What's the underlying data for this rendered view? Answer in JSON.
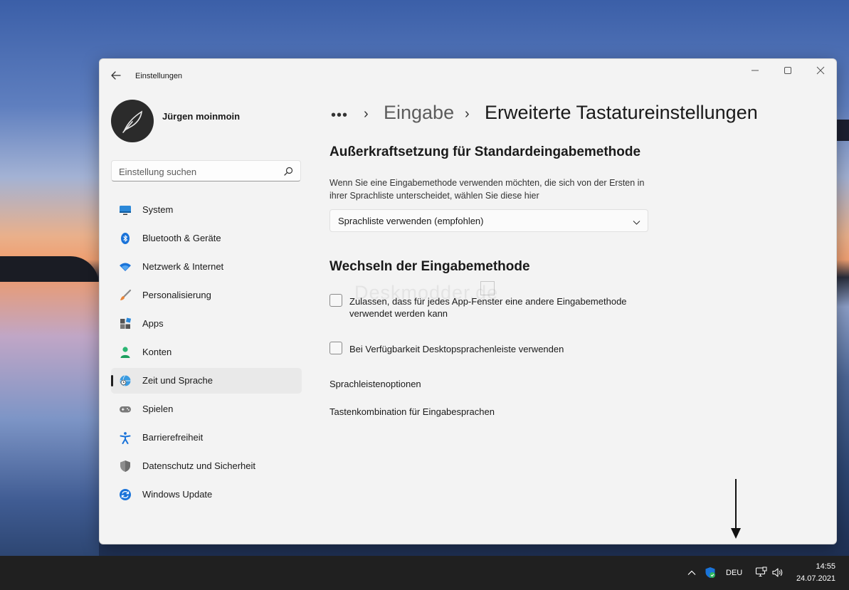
{
  "app": {
    "title": "Einstellungen"
  },
  "profile": {
    "name": "Jürgen moinmoin"
  },
  "search": {
    "placeholder": "Einstellung suchen"
  },
  "sidebar": {
    "items": [
      {
        "label": "System",
        "icon": "monitor-icon",
        "active": false
      },
      {
        "label": "Bluetooth & Geräte",
        "icon": "bluetooth-icon",
        "active": false
      },
      {
        "label": "Netzwerk & Internet",
        "icon": "wifi-icon",
        "active": false
      },
      {
        "label": "Personalisierung",
        "icon": "brush-icon",
        "active": false
      },
      {
        "label": "Apps",
        "icon": "apps-icon",
        "active": false
      },
      {
        "label": "Konten",
        "icon": "person-icon",
        "active": false
      },
      {
        "label": "Zeit und Sprache",
        "icon": "globe-clock-icon",
        "active": true
      },
      {
        "label": "Spielen",
        "icon": "gamepad-icon",
        "active": false
      },
      {
        "label": "Barrierefreiheit",
        "icon": "accessibility-icon",
        "active": false
      },
      {
        "label": "Datenschutz und Sicherheit",
        "icon": "shield-icon",
        "active": false
      },
      {
        "label": "Windows Update",
        "icon": "update-icon",
        "active": false
      }
    ]
  },
  "breadcrumb": {
    "dots": "•••",
    "separator": "›",
    "parent": "Eingabe",
    "current": "Erweiterte Tastatureinstellungen"
  },
  "main": {
    "override": {
      "title": "Außerkraftsetzung für Standardeingabemethode",
      "description": "Wenn Sie eine Eingabemethode verwenden möchten, die sich von der Ersten in ihrer Sprachliste unterscheidet, wählen Sie diese hier",
      "selected": "Sprachliste verwenden (empfohlen)"
    },
    "switching": {
      "title": "Wechseln der Eingabemethode",
      "check_per_app": {
        "label": "Zulassen, dass für jedes App-Fenster eine andere Eingabemethode verwendet werden kann",
        "checked": false
      },
      "check_desktop_bar": {
        "label": "Bei Verfügbarkeit Desktopsprachenleiste verwenden",
        "checked": false
      }
    },
    "links": {
      "language_bar_options": "Sprachleistenoptionen",
      "hotkeys": "Tastenkombination für Eingabesprachen"
    }
  },
  "watermark": "Deskmodder.de",
  "taskbar": {
    "language": "DEU",
    "time": "14:55",
    "date": "24.07.2021"
  },
  "colors": {
    "window_bg": "#f3f3f3",
    "taskbar_bg": "#202020",
    "accent_blue": "#0a64c9"
  }
}
